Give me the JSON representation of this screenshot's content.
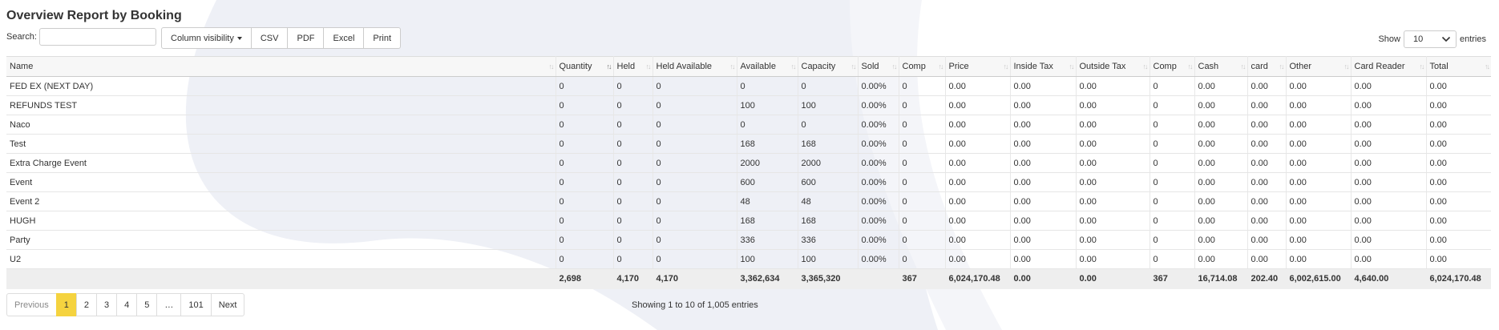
{
  "title": "Overview Report by Booking",
  "search": {
    "label": "Search:",
    "value": "",
    "placeholder": ""
  },
  "buttons": {
    "column_visibility": "Column visibility",
    "csv": "CSV",
    "pdf": "PDF",
    "excel": "Excel",
    "print": "Print"
  },
  "length": {
    "show": "Show",
    "value": "10",
    "entries": "entries"
  },
  "columns": [
    "Name",
    "Quantity",
    "Held",
    "Held Available",
    "Available",
    "Capacity",
    "Sold",
    "Comp",
    "Price",
    "Inside Tax",
    "Outside Tax",
    "Comp",
    "Cash",
    "card",
    "Other",
    "Card Reader",
    "Total"
  ],
  "rows": [
    [
      "FED EX (NEXT DAY)",
      "0",
      "0",
      "0",
      "0",
      "0",
      "0.00%",
      "0",
      "0.00",
      "0.00",
      "0.00",
      "0",
      "0.00",
      "0.00",
      "0.00",
      "0.00",
      "0.00"
    ],
    [
      "REFUNDS TEST",
      "0",
      "0",
      "0",
      "100",
      "100",
      "0.00%",
      "0",
      "0.00",
      "0.00",
      "0.00",
      "0",
      "0.00",
      "0.00",
      "0.00",
      "0.00",
      "0.00"
    ],
    [
      "Naco",
      "0",
      "0",
      "0",
      "0",
      "0",
      "0.00%",
      "0",
      "0.00",
      "0.00",
      "0.00",
      "0",
      "0.00",
      "0.00",
      "0.00",
      "0.00",
      "0.00"
    ],
    [
      "Test",
      "0",
      "0",
      "0",
      "168",
      "168",
      "0.00%",
      "0",
      "0.00",
      "0.00",
      "0.00",
      "0",
      "0.00",
      "0.00",
      "0.00",
      "0.00",
      "0.00"
    ],
    [
      "Extra Charge Event",
      "0",
      "0",
      "0",
      "2000",
      "2000",
      "0.00%",
      "0",
      "0.00",
      "0.00",
      "0.00",
      "0",
      "0.00",
      "0.00",
      "0.00",
      "0.00",
      "0.00"
    ],
    [
      "Event",
      "0",
      "0",
      "0",
      "600",
      "600",
      "0.00%",
      "0",
      "0.00",
      "0.00",
      "0.00",
      "0",
      "0.00",
      "0.00",
      "0.00",
      "0.00",
      "0.00"
    ],
    [
      "Event 2",
      "0",
      "0",
      "0",
      "48",
      "48",
      "0.00%",
      "0",
      "0.00",
      "0.00",
      "0.00",
      "0",
      "0.00",
      "0.00",
      "0.00",
      "0.00",
      "0.00"
    ],
    [
      "HUGH",
      "0",
      "0",
      "0",
      "168",
      "168",
      "0.00%",
      "0",
      "0.00",
      "0.00",
      "0.00",
      "0",
      "0.00",
      "0.00",
      "0.00",
      "0.00",
      "0.00"
    ],
    [
      "Party",
      "0",
      "0",
      "0",
      "336",
      "336",
      "0.00%",
      "0",
      "0.00",
      "0.00",
      "0.00",
      "0",
      "0.00",
      "0.00",
      "0.00",
      "0.00",
      "0.00"
    ],
    [
      "U2",
      "0",
      "0",
      "0",
      "100",
      "100",
      "0.00%",
      "0",
      "0.00",
      "0.00",
      "0.00",
      "0",
      "0.00",
      "0.00",
      "0.00",
      "0.00",
      "0.00"
    ]
  ],
  "totals": [
    "",
    "2,698",
    "4,170",
    "4,170",
    "3,362,634",
    "3,365,320",
    "",
    "367",
    "6,024,170.48",
    "0.00",
    "0.00",
    "367",
    "16,714.08",
    "202.40",
    "6,002,615.00",
    "4,640.00",
    "6,024,170.48"
  ],
  "pagination": {
    "previous": "Previous",
    "pages": [
      "1",
      "2",
      "3",
      "4",
      "5",
      "…",
      "101"
    ],
    "next": "Next"
  },
  "info": "Showing 1 to 10 of 1,005 entries",
  "colors": {
    "accent": "#f5d33f",
    "watermark": "#eef0f6"
  },
  "icons": {
    "sort": "sort-both-icon",
    "sort_active": "sort-asc-icon",
    "select": "chevron-down-icon",
    "dropdown": "caret-down-icon"
  }
}
